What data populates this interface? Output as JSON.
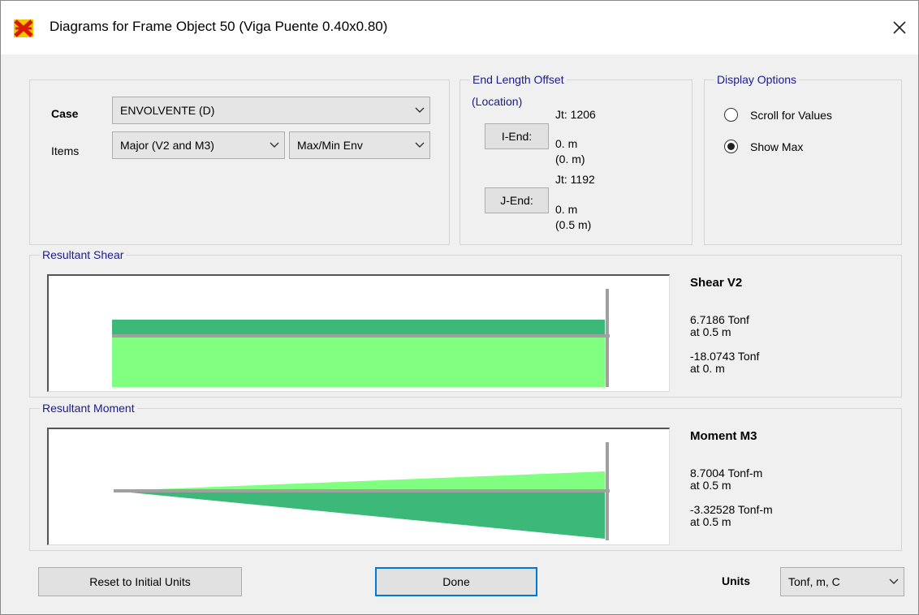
{
  "window": {
    "title": "Diagrams for Frame Object 50  (Viga Puente 0.40x0.80)"
  },
  "case_panel": {
    "case_label": "Case",
    "case_value": "ENVOLVENTE (D)",
    "items_label": "Items",
    "items_value": "Major (V2 and M3)",
    "env_value": "Max/Min Env"
  },
  "end_offset": {
    "legend": "End Length Offset",
    "location_label": "(Location)",
    "i_end_button": "I-End:",
    "j_end_button": "J-End:",
    "jt_i": "Jt:  1206",
    "i_value": "0. m",
    "i_location": "(0. m)",
    "jt_j": "Jt:  1192",
    "j_value": "0. m",
    "j_location": "(0.5 m)"
  },
  "display_options": {
    "legend": "Display Options",
    "scroll_label": "Scroll for Values",
    "show_max_label": "Show Max",
    "selected": "show_max"
  },
  "shear": {
    "legend": "Resultant Shear",
    "title": "Shear V2",
    "max_value": "6.7186 Tonf",
    "max_at": "at 0.5 m",
    "min_value": "-18.0743 Tonf",
    "min_at": "at 0. m"
  },
  "moment": {
    "legend": "Resultant Moment",
    "title": "Moment M3",
    "max_value": "8.7004 Tonf-m",
    "max_at": "at 0.5 m",
    "min_value": "-3.32528 Tonf-m",
    "min_at": "at 0.5 m"
  },
  "footer": {
    "reset_button": "Reset to Initial Units",
    "done_button": "Done",
    "units_label": "Units",
    "units_value": "Tonf, m, C"
  },
  "colors": {
    "dark_green": "#3cb878",
    "light_green": "#80ff80",
    "axis_gray": "#a0a0a0",
    "legend_blue": "#1a1a8c",
    "accent_blue": "#0078d7"
  }
}
